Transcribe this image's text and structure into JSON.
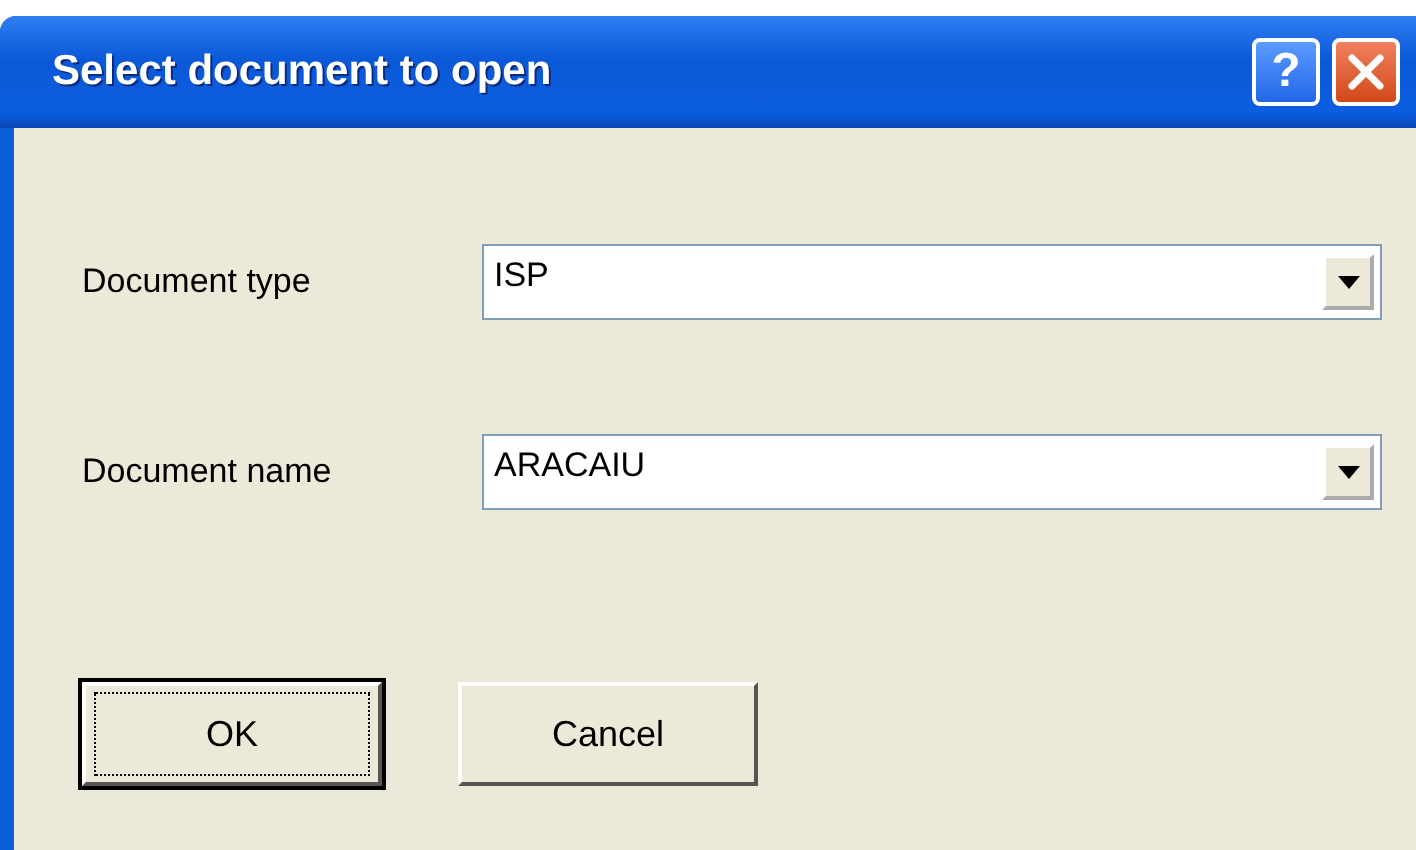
{
  "window": {
    "title": "Select document to open",
    "help_glyph": "?"
  },
  "fields": [
    {
      "label": "Document type",
      "value": "ISP"
    },
    {
      "label": "Document name",
      "value": "ARACAIU"
    }
  ],
  "buttons": [
    {
      "label": "OK",
      "focused": true
    },
    {
      "label": "Cancel",
      "focused": false
    }
  ]
}
